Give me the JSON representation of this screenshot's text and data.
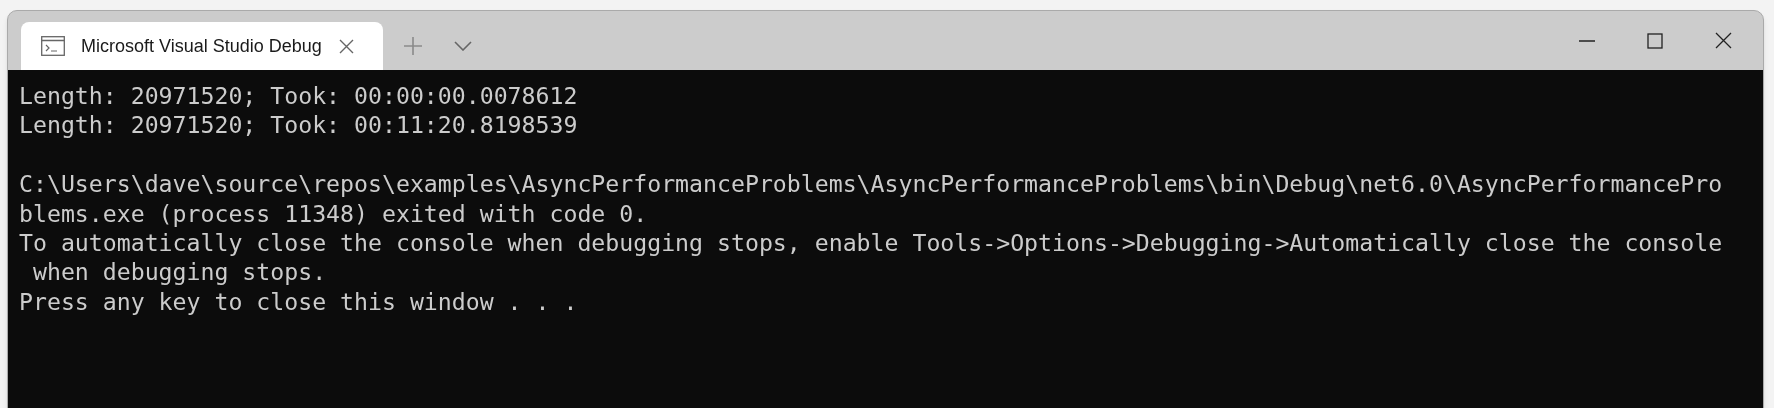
{
  "tabs": [
    {
      "title": "Microsoft Visual Studio Debug",
      "selected": true
    }
  ],
  "console": {
    "lines": [
      {
        "kind": "text",
        "text": "Length: 20971520; Took: 00:00:00.0078612"
      },
      {
        "kind": "text",
        "text": "Length: 20971520; Took: 00:11:20.8198539"
      },
      {
        "kind": "blank"
      },
      {
        "kind": "text",
        "text": "C:\\Users\\dave\\source\\repos\\examples\\AsyncPerformanceProblems\\AsyncPerformanceProblems\\bin\\Debug\\net6.0\\AsyncPerformancePro"
      },
      {
        "kind": "text",
        "text": "blems.exe (process 11348) exited with code 0."
      },
      {
        "kind": "text",
        "text": "To automatically close the console when debugging stops, enable Tools->Options->Debugging->Automatically close the console"
      },
      {
        "kind": "text",
        "text": " when debugging stops."
      },
      {
        "kind": "text",
        "text": "Press any key to close this window . . ."
      }
    ]
  }
}
